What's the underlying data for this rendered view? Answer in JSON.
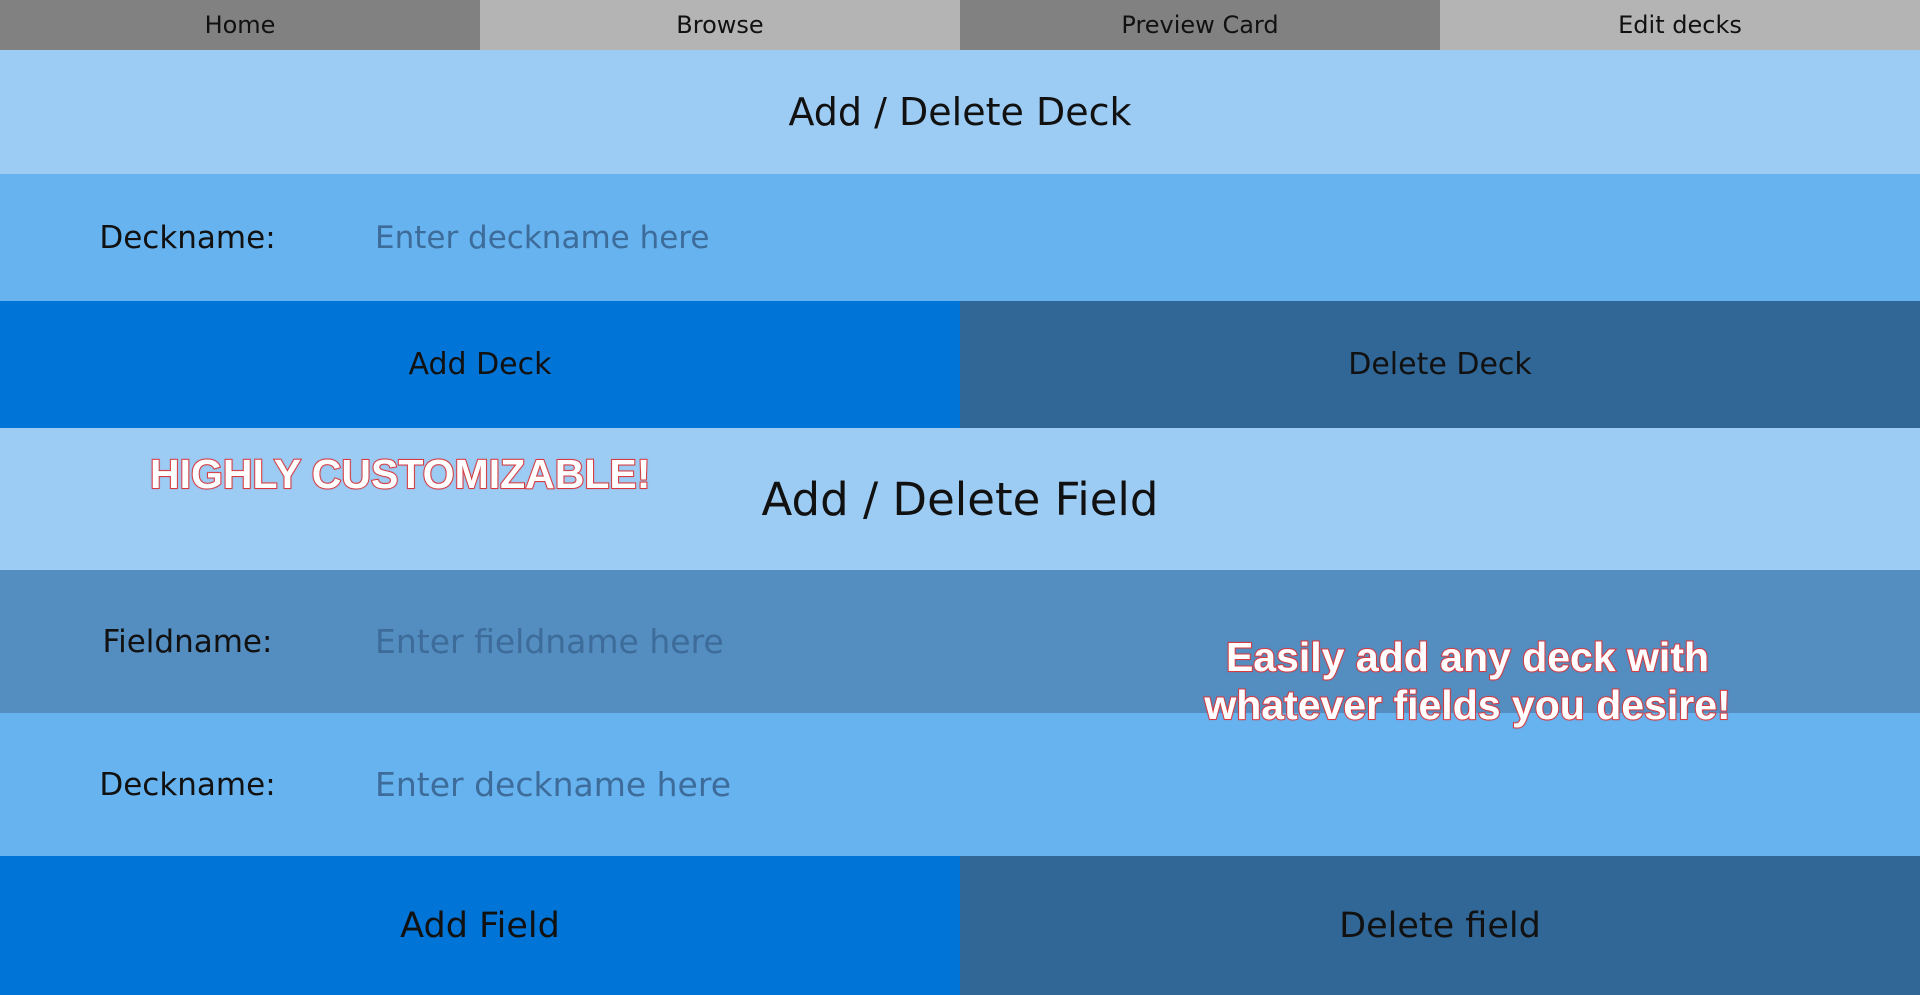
{
  "nav": {
    "tabs": [
      {
        "label": "Home"
      },
      {
        "label": "Browse"
      },
      {
        "label": "Preview Card"
      },
      {
        "label": "Edit decks"
      }
    ]
  },
  "deck_section": {
    "title": "Add / Delete Deck",
    "deckname_label": "Deckname:",
    "deckname_placeholder": "Enter deckname here",
    "add_label": "Add Deck",
    "delete_label": "Delete Deck"
  },
  "field_section": {
    "title": "Add / Delete Field",
    "fieldname_label": "Fieldname:",
    "fieldname_placeholder": "Enter fieldname here",
    "deckname_label": "Deckname:",
    "deckname_placeholder": "Enter deckname here",
    "add_label": "Add Field",
    "delete_label": "Delete field"
  },
  "promo": {
    "headline": "HIGHLY CUSTOMIZABLE!",
    "caption_line1": "Easily add any deck with",
    "caption_line2": "whatever fields you desire!"
  },
  "colors": {
    "nav_dark": "#818181",
    "nav_light": "#b4b4b5",
    "title_bg": "#9ccbf4",
    "input_bg": "#67b3ef",
    "input_alt_bg": "#548dc0",
    "add_button": "#0175d7",
    "delete_button": "#316797",
    "promo_outline": "#d63a3f"
  }
}
